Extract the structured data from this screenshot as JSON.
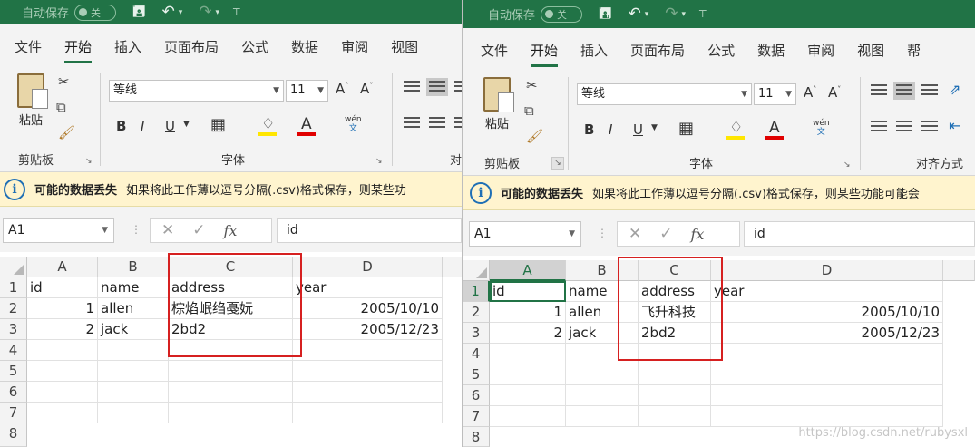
{
  "windows": [
    {
      "id": "left",
      "titlebar": {
        "autosave_label": "自动保存",
        "autosave_state": "关"
      },
      "tabs": [
        "文件",
        "开始",
        "插入",
        "页面布局",
        "公式",
        "数据",
        "审阅",
        "视图"
      ],
      "active_tab": "开始",
      "ribbon": {
        "paste_label": "粘贴",
        "clipboard_label": "剪贴板",
        "font_name": "等线",
        "font_size": "11",
        "font_group_label": "字体",
        "partial_group_label": "对",
        "wen_label": "wén",
        "wen_sub": "文"
      },
      "infobar": {
        "title": "可能的数据丢失",
        "message": "如果将此工作薄以逗号分隔(.csv)格式保存，则某些功"
      },
      "formula_bar": {
        "name_box": "A1",
        "formula": "id",
        "fx": "fx"
      },
      "columns": [
        "A",
        "B",
        "C",
        "D"
      ],
      "rows": [
        "1",
        "2",
        "3",
        "4",
        "5",
        "6",
        "7",
        "8"
      ],
      "cells": [
        [
          "id",
          "name",
          "address",
          "year"
        ],
        [
          "1",
          "allen",
          "棕焰岷绉戞妧",
          "2005/10/10"
        ],
        [
          "2",
          "jack",
          "2bd2",
          "2005/12/23"
        ]
      ]
    },
    {
      "id": "right",
      "titlebar": {
        "autosave_label": "自动保存",
        "autosave_state": "关"
      },
      "tabs": [
        "文件",
        "开始",
        "插入",
        "页面布局",
        "公式",
        "数据",
        "审阅",
        "视图",
        "帮"
      ],
      "active_tab": "开始",
      "ribbon": {
        "paste_label": "粘贴",
        "clipboard_label": "剪贴板",
        "font_name": "等线",
        "font_size": "11",
        "font_group_label": "字体",
        "align_group_label": "对齐方式",
        "wen_label": "wén",
        "wen_sub": "文"
      },
      "infobar": {
        "title": "可能的数据丢失",
        "message": "如果将此工作薄以逗号分隔(.csv)格式保存，则某些功能可能会"
      },
      "formula_bar": {
        "name_box": "A1",
        "formula": "id",
        "fx": "fx"
      },
      "columns": [
        "A",
        "B",
        "C",
        "D"
      ],
      "rows": [
        "1",
        "2",
        "3",
        "4",
        "5",
        "6",
        "7",
        "8"
      ],
      "cells": [
        [
          "id",
          "name",
          "address",
          "year"
        ],
        [
          "1",
          "allen",
          "飞升科技",
          "2005/10/10"
        ],
        [
          "2",
          "jack",
          "2bd2",
          "2005/12/23"
        ]
      ],
      "watermark": "https://blog.csdn.net/rubysxl"
    }
  ],
  "colors": {
    "excel_green": "#217346",
    "highlight_box": "#d62020",
    "info_bg": "#fff4ce",
    "font_yellow": "#ffe600",
    "font_red": "#e00000"
  },
  "icons": [
    "save-icon",
    "undo-icon",
    "redo-icon",
    "paste-icon",
    "cut-icon",
    "copy-icon",
    "format-painter-icon",
    "info-icon",
    "cancel-icon",
    "enter-icon",
    "function-icon"
  ]
}
